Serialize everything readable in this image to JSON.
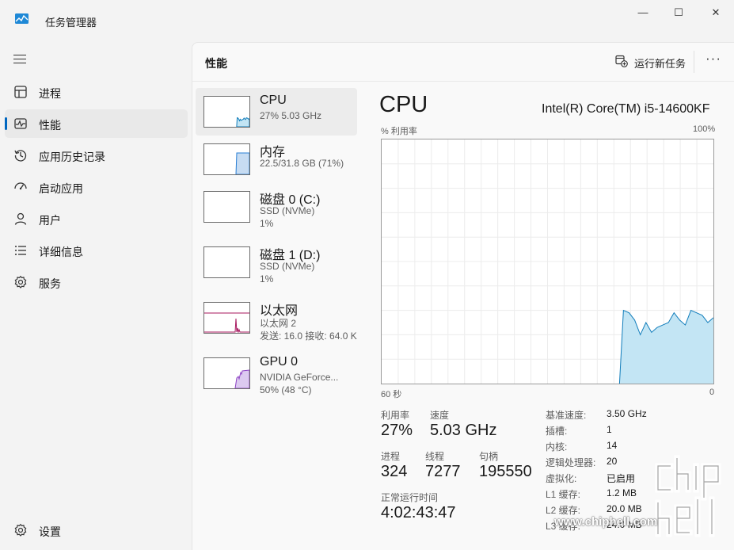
{
  "window": {
    "title": "任务管理器",
    "controls": {
      "minimize": "—",
      "maximize": "☐",
      "close": "✕"
    }
  },
  "nav": {
    "items": [
      {
        "label": "进程",
        "icon": "processes-icon"
      },
      {
        "label": "性能",
        "icon": "performance-icon",
        "active": true
      },
      {
        "label": "应用历史记录",
        "icon": "app-history-icon"
      },
      {
        "label": "启动应用",
        "icon": "startup-apps-icon"
      },
      {
        "label": "用户",
        "icon": "users-icon"
      },
      {
        "label": "详细信息",
        "icon": "details-icon"
      },
      {
        "label": "服务",
        "icon": "services-icon"
      }
    ],
    "settings": {
      "label": "设置",
      "icon": "settings-icon"
    }
  },
  "header": {
    "title": "性能",
    "run_task": "运行新任务",
    "more": "···"
  },
  "resources": [
    {
      "name": "CPU",
      "sub1": "27%  5.03 GHz",
      "graph_color": "#117dbb",
      "fill": "#c3e5f4"
    },
    {
      "name": "内存",
      "sub1": "22.5/31.8 GB (71%)",
      "graph_color": "#2a7fd4",
      "fill": "#c7dcf2"
    },
    {
      "name": "磁盘 0 (C:)",
      "sub1": "SSD (NVMe)",
      "sub2": "1%"
    },
    {
      "name": "磁盘 1 (D:)",
      "sub1": "SSD (NVMe)",
      "sub2": "1%"
    },
    {
      "name": "以太网",
      "sub1": "以太网 2",
      "sub2": "发送: 16.0  接收: 64.0 K",
      "graph_color": "#a7175e"
    },
    {
      "name": "GPU 0",
      "sub1": "NVIDIA GeForce...",
      "sub2": "50%  (48 °C)",
      "graph_color": "#8e44c4",
      "fill": "#dccaf0"
    }
  ],
  "detail": {
    "title": "CPU",
    "model": "Intel(R) Core(TM) i5-14600KF",
    "chart_top_left": "% 利用率",
    "chart_top_right": "100%",
    "chart_bottom_left": "60 秒",
    "chart_bottom_right": "0",
    "stats": {
      "utilization_label": "利用率",
      "utilization": "27%",
      "speed_label": "速度",
      "speed": "5.03 GHz",
      "processes_label": "进程",
      "processes": "324",
      "threads_label": "线程",
      "threads": "7277",
      "handles_label": "句柄",
      "handles": "195550",
      "uptime_label": "正常运行时间",
      "uptime": "4:02:43:47"
    },
    "specs": [
      {
        "key": "基准速度:",
        "value": "3.50 GHz"
      },
      {
        "key": "插槽:",
        "value": "1"
      },
      {
        "key": "内核:",
        "value": "14"
      },
      {
        "key": "逻辑处理器:",
        "value": "20"
      },
      {
        "key": "虚拟化:",
        "value": "已启用"
      },
      {
        "key": "L1 缓存:",
        "value": "1.2 MB"
      },
      {
        "key": "L2 缓存:",
        "value": "20.0 MB"
      },
      {
        "key": "L3 缓存:",
        "value": "24.0 MB"
      }
    ]
  },
  "chart_data": {
    "type": "area",
    "ylim": [
      0,
      100
    ],
    "xlim": [
      60,
      0
    ],
    "xlabel": "60 秒",
    "ylabel": "% 利用率",
    "grid": true,
    "series": [
      {
        "values": [
          0,
          0,
          0,
          0,
          0,
          0,
          0,
          0,
          0,
          0,
          0,
          0,
          0,
          0,
          0,
          0,
          0,
          0,
          0,
          0,
          0,
          0,
          0,
          0,
          0,
          0,
          0,
          0,
          0,
          0,
          0,
          0,
          0,
          0,
          0,
          0,
          0,
          0,
          0,
          0,
          0,
          0,
          0,
          30,
          29,
          26,
          20,
          25,
          21,
          23,
          24,
          25,
          29,
          26,
          24,
          30,
          29,
          28,
          25,
          27
        ]
      }
    ]
  },
  "watermark": {
    "url": "www.chiphell.com"
  }
}
